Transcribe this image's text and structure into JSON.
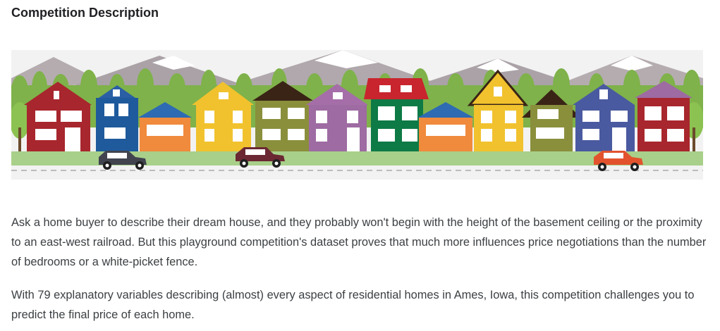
{
  "section": {
    "title": "Competition Description"
  },
  "banner": {
    "image": "illustration of a street of colorful houses with mountains, trees and cars"
  },
  "description": {
    "paragraph1": "Ask a home buyer to describe their dream house, and they probably won't begin with the height of the basement ceiling or the proximity to an east-west railroad. But this playground competition's dataset proves that much more influences price negotiations than the number of bedrooms or a white-picket fence.",
    "paragraph2": "With 79 explanatory variables describing (almost) every aspect of residential homes in Ames, Iowa, this competition challenges you to predict the final price of each home."
  }
}
